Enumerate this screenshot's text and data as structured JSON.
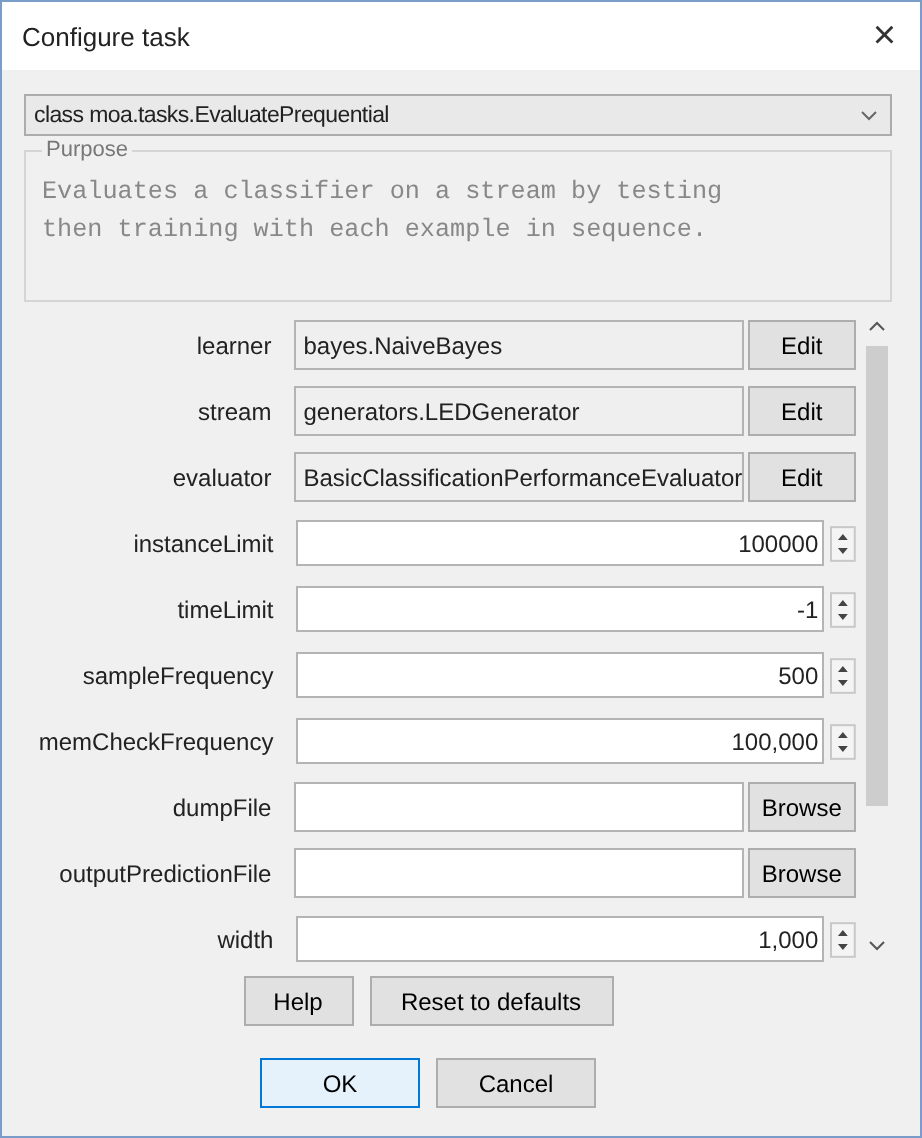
{
  "window": {
    "title": "Configure task",
    "close": "×"
  },
  "task_selector": {
    "value": "class moa.tasks.EvaluatePrequential"
  },
  "purpose": {
    "legend": "Purpose",
    "text": "Evaluates a classifier on a stream by testing\nthen training with each example in sequence."
  },
  "options": [
    {
      "kind": "object",
      "label": "learner",
      "value": "bayes.NaiveBayes",
      "button": "Edit"
    },
    {
      "kind": "object",
      "label": "stream",
      "value": "generators.LEDGenerator",
      "button": "Edit"
    },
    {
      "kind": "object",
      "label": "evaluator",
      "value": "BasicClassificationPerformanceEvaluator",
      "button": "Edit"
    },
    {
      "kind": "number",
      "label": "instanceLimit",
      "value": "100000"
    },
    {
      "kind": "number",
      "label": "timeLimit",
      "value": "-1"
    },
    {
      "kind": "number",
      "label": "sampleFrequency",
      "value": "500"
    },
    {
      "kind": "number",
      "label": "memCheckFrequency",
      "value": "100,000"
    },
    {
      "kind": "file",
      "label": "dumpFile",
      "button": "Browse"
    },
    {
      "kind": "file",
      "label": "outputPredictionFile",
      "button": "Browse"
    },
    {
      "kind": "number",
      "label": "width",
      "value": "1,000"
    }
  ],
  "buttons_row_1": [
    "Help",
    "Reset to defaults"
  ],
  "buttons_row_2": [
    {
      "label": "OK",
      "selected": true
    },
    {
      "label": "Cancel",
      "selected": false
    }
  ]
}
